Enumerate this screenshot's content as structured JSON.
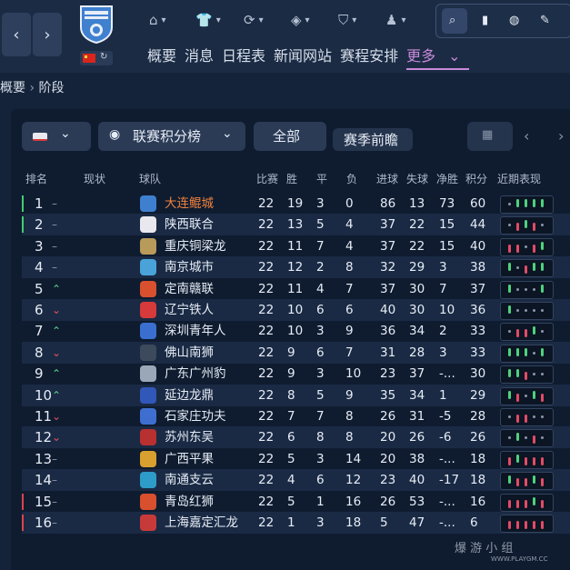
{
  "topnav": {
    "tabs": [
      "概要",
      "消息",
      "日程表",
      "新闻网站",
      "赛程安排"
    ],
    "active_tab": "更多"
  },
  "breadcrumb": {
    "parent": "概要",
    "current": "阶段"
  },
  "controls": {
    "table_type": "联赛积分榜",
    "filter": "全部",
    "preview": "赛季前瞻"
  },
  "headers": {
    "pos": "排名",
    "move": "现状",
    "team": "球队",
    "played": "比赛",
    "won": "胜",
    "drawn": "平",
    "lost": "负",
    "gf": "进球",
    "ga": "失球",
    "gd": "净胜",
    "pts": "积分",
    "form": "近期表现"
  },
  "colors": {
    "promotion": "#3fcf6e",
    "relegation": "#e0414b",
    "highlight_team": "#f0823c",
    "win": "#4fd27c",
    "draw": "#8a97ab",
    "loss": "#e24c66"
  },
  "rows": [
    {
      "pos": "1",
      "move": "same",
      "team": "大连鲲城",
      "p": "22",
      "w": "19",
      "d": "3",
      "l": "0",
      "gf": "86",
      "ga": "13",
      "gd": "73",
      "pts": "60",
      "zone": "promo",
      "logo": "#3f7fd0",
      "form": [
        "D",
        "W",
        "W",
        "W",
        "W"
      ],
      "highlight": true
    },
    {
      "pos": "2",
      "move": "same",
      "team": "陕西联合",
      "p": "22",
      "w": "13",
      "d": "5",
      "l": "4",
      "gf": "37",
      "ga": "22",
      "gd": "15",
      "pts": "44",
      "zone": "promo",
      "logo": "#e8e8ee",
      "form": [
        "D",
        "L",
        "W",
        "L",
        "D"
      ]
    },
    {
      "pos": "3",
      "move": "same",
      "team": "重庆铜梁龙",
      "p": "22",
      "w": "11",
      "d": "7",
      "l": "4",
      "gf": "37",
      "ga": "22",
      "gd": "15",
      "pts": "40",
      "zone": "",
      "logo": "#b89a5a",
      "form": [
        "L",
        "L",
        "D",
        "L",
        "W"
      ]
    },
    {
      "pos": "4",
      "move": "same",
      "team": "南京城市",
      "p": "22",
      "w": "12",
      "d": "2",
      "l": "8",
      "gf": "32",
      "ga": "29",
      "gd": "3",
      "pts": "38",
      "zone": "",
      "logo": "#4aa3d8",
      "form": [
        "W",
        "D",
        "L",
        "W",
        "W"
      ]
    },
    {
      "pos": "5",
      "move": "up",
      "team": "定南赣联",
      "p": "22",
      "w": "11",
      "d": "4",
      "l": "7",
      "gf": "37",
      "ga": "30",
      "gd": "7",
      "pts": "37",
      "zone": "",
      "logo": "#d8502e",
      "form": [
        "W",
        "D",
        "D",
        "D",
        "W"
      ]
    },
    {
      "pos": "6",
      "move": "down",
      "team": "辽宁铁人",
      "p": "22",
      "w": "10",
      "d": "6",
      "l": "6",
      "gf": "40",
      "ga": "30",
      "gd": "10",
      "pts": "36",
      "zone": "",
      "logo": "#d63a3a",
      "form": [
        "W",
        "D",
        "D",
        "D",
        "D"
      ]
    },
    {
      "pos": "7",
      "move": "up",
      "team": "深圳青年人",
      "p": "22",
      "w": "10",
      "d": "3",
      "l": "9",
      "gf": "36",
      "ga": "34",
      "gd": "2",
      "pts": "33",
      "zone": "",
      "logo": "#3a6fcf",
      "form": [
        "D",
        "L",
        "L",
        "W",
        "D"
      ]
    },
    {
      "pos": "8",
      "move": "down",
      "team": "佛山南狮",
      "p": "22",
      "w": "9",
      "d": "6",
      "l": "7",
      "gf": "31",
      "ga": "28",
      "gd": "3",
      "pts": "33",
      "zone": "",
      "logo": "#3d4a5c",
      "form": [
        "W",
        "W",
        "W",
        "D",
        "W"
      ]
    },
    {
      "pos": "9",
      "move": "up",
      "team": "广东广州豹",
      "p": "22",
      "w": "9",
      "d": "3",
      "l": "10",
      "gf": "23",
      "ga": "37",
      "gd": "-...",
      "pts": "30",
      "zone": "",
      "logo": "#9aa7b8",
      "form": [
        "W",
        "W",
        "L",
        "D",
        "D"
      ]
    },
    {
      "pos": "10",
      "move": "up",
      "team": "延边龙鼎",
      "p": "22",
      "w": "8",
      "d": "5",
      "l": "9",
      "gf": "35",
      "ga": "34",
      "gd": "1",
      "pts": "29",
      "zone": "",
      "logo": "#3157b8",
      "form": [
        "W",
        "L",
        "D",
        "W",
        "L"
      ]
    },
    {
      "pos": "11",
      "move": "down",
      "team": "石家庄功夫",
      "p": "22",
      "w": "7",
      "d": "7",
      "l": "8",
      "gf": "26",
      "ga": "31",
      "gd": "-5",
      "pts": "28",
      "zone": "",
      "logo": "#3e6fd0",
      "form": [
        "D",
        "L",
        "L",
        "D",
        "D"
      ]
    },
    {
      "pos": "12",
      "move": "down",
      "team": "苏州东吴",
      "p": "22",
      "w": "6",
      "d": "8",
      "l": "8",
      "gf": "20",
      "ga": "26",
      "gd": "-6",
      "pts": "26",
      "zone": "",
      "logo": "#b83030",
      "form": [
        "D",
        "W",
        "D",
        "L",
        "D"
      ]
    },
    {
      "pos": "13",
      "move": "same",
      "team": "广西平果",
      "p": "22",
      "w": "5",
      "d": "3",
      "l": "14",
      "gf": "20",
      "ga": "38",
      "gd": "-...",
      "pts": "18",
      "zone": "",
      "logo": "#d8a02e",
      "form": [
        "L",
        "W",
        "L",
        "L",
        "L"
      ]
    },
    {
      "pos": "14",
      "move": "same",
      "team": "南通支云",
      "p": "22",
      "w": "4",
      "d": "6",
      "l": "12",
      "gf": "23",
      "ga": "40",
      "gd": "-17",
      "pts": "18",
      "zone": "",
      "logo": "#2e9cc8",
      "form": [
        "W",
        "L",
        "L",
        "W",
        "L"
      ]
    },
    {
      "pos": "15",
      "move": "same",
      "team": "青岛红狮",
      "p": "22",
      "w": "5",
      "d": "1",
      "l": "16",
      "gf": "26",
      "ga": "53",
      "gd": "-...",
      "pts": "16",
      "zone": "releg",
      "logo": "#d8502e",
      "form": [
        "L",
        "L",
        "L",
        "W",
        "L"
      ]
    },
    {
      "pos": "16",
      "move": "same",
      "team": "上海嘉定汇龙",
      "p": "22",
      "w": "1",
      "d": "3",
      "l": "18",
      "gf": "5",
      "ga": "47",
      "gd": "-...",
      "pts": "6",
      "zone": "releg",
      "logo": "#c83a3a",
      "form": [
        "L",
        "L",
        "L",
        "L",
        "L"
      ]
    }
  ],
  "watermark": {
    "text": "爆 游 小 组",
    "url": "WWW.PLAYGM.CC"
  }
}
